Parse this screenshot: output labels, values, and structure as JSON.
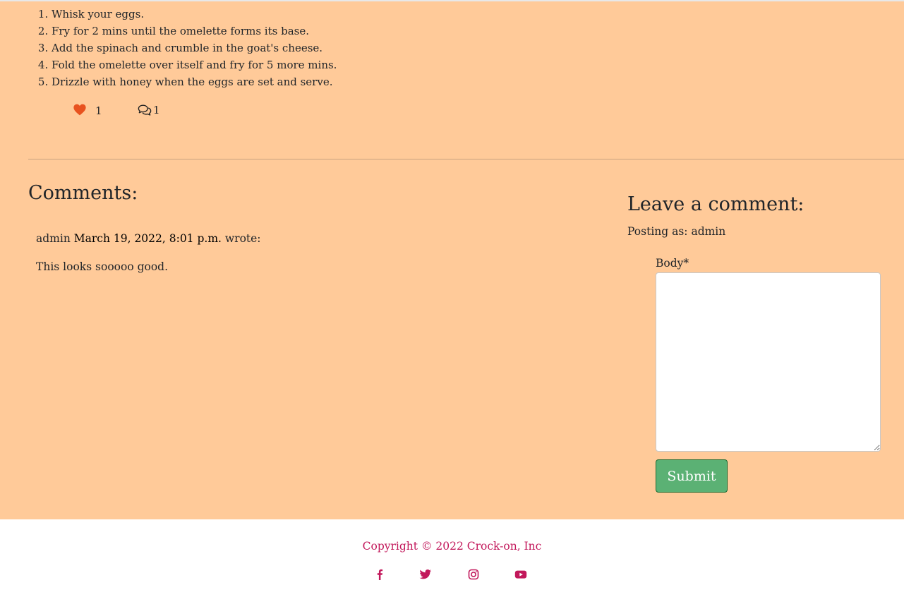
{
  "recipe": {
    "steps": [
      "Whisk your eggs.",
      "Fry for 2 mins until the omelette forms its base.",
      "Add the spinach and crumble in the goat's cheese.",
      "Fold the omelette over itself and fry for 5 more mins.",
      "Drizzle with honey when the eggs are set and serve."
    ],
    "like_count": "1",
    "comment_count": "1"
  },
  "comments": {
    "title": "Comments:",
    "items": [
      {
        "author": "admin",
        "date": "March 19, 2022, 8:01 p.m.",
        "wrote": "wrote:",
        "body": "This looks sooooo good."
      }
    ]
  },
  "comment_form": {
    "title": "Leave a comment:",
    "posting_as": "Posting as: admin",
    "body_label": "Body*",
    "body_value": "",
    "submit_label": "Submit"
  },
  "footer": {
    "copyright": "Copyright © 2022 Crock-on, Inc",
    "social_icons": [
      "facebook-icon",
      "twitter-icon",
      "instagram-icon",
      "youtube-icon"
    ]
  },
  "colors": {
    "page_background": "#ffca99",
    "like_heart": "#e8521f",
    "submit_button": "#5bb174",
    "footer_accent": "#c2185b"
  }
}
